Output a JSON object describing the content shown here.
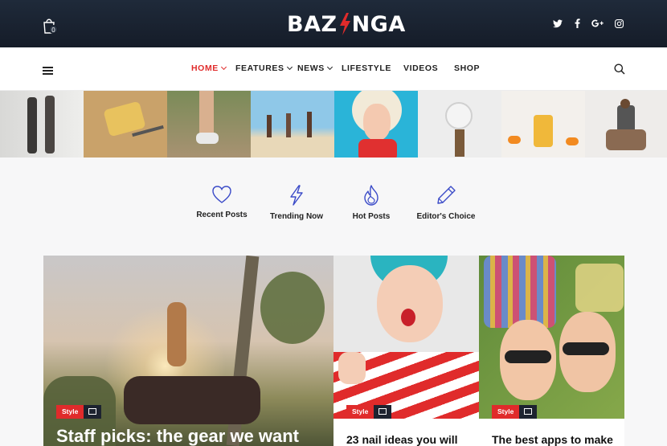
{
  "header": {
    "cart_count": "0",
    "logo_left": "BAZ",
    "logo_right": "NGA",
    "social": [
      "twitter-icon",
      "facebook-icon",
      "google-plus-icon",
      "instagram-icon"
    ]
  },
  "nav": {
    "items": [
      {
        "label": "HOME",
        "active": true,
        "dropdown": true
      },
      {
        "label": "FEATURES",
        "dropdown": true
      },
      {
        "label": "NEWS",
        "dropdown": true
      },
      {
        "label": "LIFESTYLE"
      },
      {
        "label": "VIDEOS"
      },
      {
        "label": "SHOP"
      }
    ]
  },
  "categories": [
    {
      "label": "Recent Posts",
      "icon": "heart-icon"
    },
    {
      "label": "Trending Now",
      "icon": "bolt-icon"
    },
    {
      "label": "Hot Posts",
      "icon": "flame-icon"
    },
    {
      "label": "Editor's Choice",
      "icon": "pencil-icon"
    }
  ],
  "posts": [
    {
      "tag": "Style",
      "title": "Staff picks: the gear we want"
    },
    {
      "tag": "Style",
      "title": "23 nail ideas you will"
    },
    {
      "tag": "Style",
      "title": "The best apps to make"
    }
  ],
  "colors": {
    "accent": "#e02b2b",
    "dark": "#151c28",
    "category_icon": "#3b4bc8"
  }
}
